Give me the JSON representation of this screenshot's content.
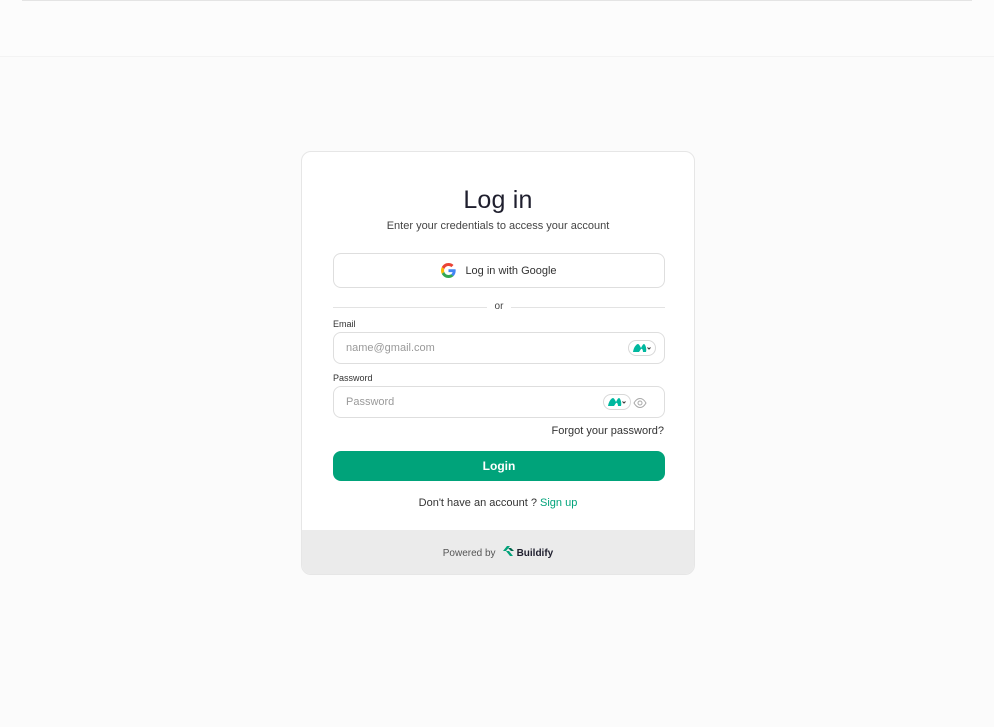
{
  "header": {},
  "login": {
    "title": "Log in",
    "subtitle": "Enter your credentials to access your account",
    "google_button_label": "Log in with Google",
    "divider_text": "or",
    "email_label": "Email",
    "email_placeholder": "name@gmail.com",
    "password_label": "Password",
    "password_placeholder": "Password",
    "forgot_password": "Forgot your password?",
    "login_button": "Login",
    "no_account_text": "Don't have an account ?",
    "signup_link": "Sign up"
  },
  "footer": {
    "powered_by": "Powered by",
    "brand": "Buildify"
  },
  "icons": {
    "google": "google-icon",
    "extension": "password-manager-extension-icon",
    "eye": "eye-icon",
    "brand_logo": "buildify-logo-icon"
  },
  "colors": {
    "accent": "#00a37a",
    "background": "#fbfbfb",
    "card": "#ffffff",
    "footer": "#ebebeb"
  }
}
